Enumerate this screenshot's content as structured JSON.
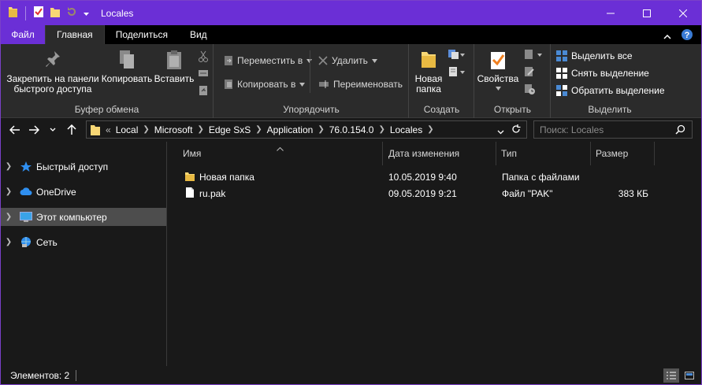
{
  "window": {
    "title": "Locales"
  },
  "ribbon_tabs": [
    {
      "label": "Файл"
    },
    {
      "label": "Главная"
    },
    {
      "label": "Поделиться"
    },
    {
      "label": "Вид"
    }
  ],
  "ribbon": {
    "clipboard": {
      "title": "Буфер обмена",
      "pin_line1": "Закрепить на панели",
      "pin_line2": "быстрого доступа",
      "copy": "Копировать",
      "paste": "Вставить"
    },
    "organize": {
      "title": "Упорядочить",
      "move_to": "Переместить в",
      "copy_to": "Копировать в",
      "delete": "Удалить",
      "rename": "Переименовать"
    },
    "new": {
      "title": "Создать",
      "new_folder_line1": "Новая",
      "new_folder_line2": "папка"
    },
    "open": {
      "title": "Открыть",
      "properties": "Свойства"
    },
    "select": {
      "title": "Выделить",
      "select_all": "Выделить все",
      "select_none": "Снять выделение",
      "invert": "Обратить выделение"
    }
  },
  "address": {
    "overflow": "«",
    "crumbs": [
      "Local",
      "Microsoft",
      "Edge SxS",
      "Application",
      "76.0.154.0",
      "Locales"
    ],
    "search_placeholder": "Поиск: Locales"
  },
  "nav_pane": {
    "items": [
      {
        "label": "Быстрый доступ",
        "icon": "star-icon",
        "selected": false
      },
      {
        "label": "OneDrive",
        "icon": "cloud-icon",
        "selected": false
      },
      {
        "label": "Этот компьютер",
        "icon": "computer-icon",
        "selected": true
      },
      {
        "label": "Сеть",
        "icon": "network-icon",
        "selected": false
      }
    ]
  },
  "columns": {
    "name": "Имя",
    "date": "Дата изменения",
    "type": "Тип",
    "size": "Размер"
  },
  "files": [
    {
      "name": "Новая папка",
      "date": "10.05.2019 9:40",
      "type": "Папка с файлами",
      "size": "",
      "icon": "folder-icon"
    },
    {
      "name": "ru.pak",
      "date": "09.05.2019 9:21",
      "type": "Файл \"PAK\"",
      "size": "383 КБ",
      "icon": "file-icon"
    }
  ],
  "status": {
    "items_count": "Элементов: 2"
  },
  "colors": {
    "accent": "#6b2fd6",
    "background": "#191919",
    "ribbon": "#2b2b2b",
    "selected": "#4d4d4d"
  }
}
